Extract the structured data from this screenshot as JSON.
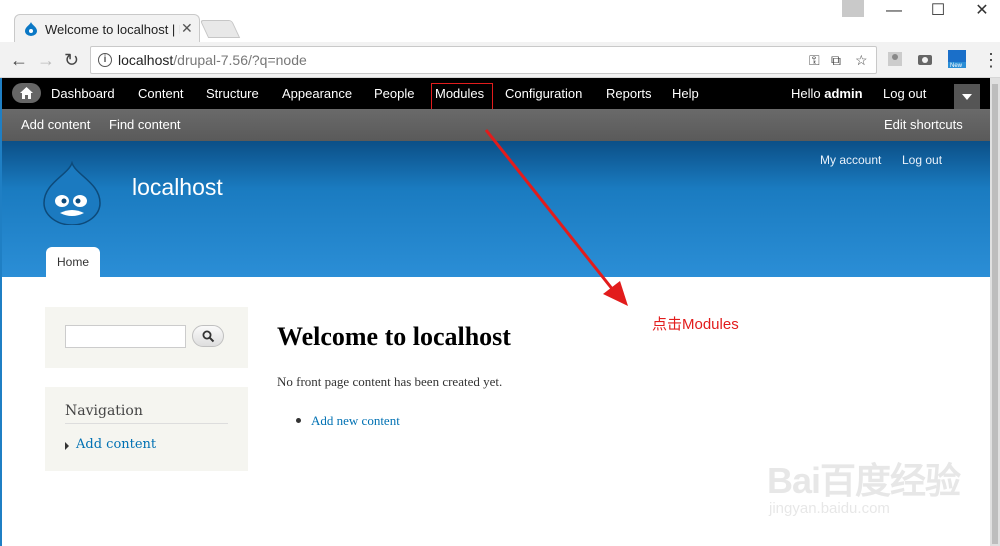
{
  "browser": {
    "tab_title": "Welcome to localhost | Drupal",
    "url_host": "localhost",
    "url_path": "/drupal-7.56/?q=node",
    "window_buttons": [
      "—",
      "☐",
      "✕"
    ]
  },
  "toolbar": {
    "items": [
      "Dashboard",
      "Content",
      "Structure",
      "Appearance",
      "People",
      "Modules",
      "Configuration",
      "Reports",
      "Help"
    ],
    "hello_prefix": "Hello ",
    "username": "admin",
    "logout": "Log out"
  },
  "shortcuts": {
    "add_content": "Add content",
    "find_content": "Find content",
    "edit_shortcuts": "Edit shortcuts"
  },
  "header": {
    "my_account": "My account",
    "logout": "Log out",
    "site_name": "localhost",
    "home_tab": "Home"
  },
  "sidebar": {
    "search_placeholder": "",
    "nav_title": "Navigation",
    "nav_link": "Add content"
  },
  "main": {
    "title": "Welcome to localhost",
    "text": "No front page content has been created yet.",
    "link": "Add new content"
  },
  "annotation": {
    "label": "点击Modules"
  },
  "watermark": {
    "text": "Bai百度经验",
    "sub": "jingyan.baidu.com"
  },
  "colors": {
    "accent": "#0071b3",
    "annotation": "#e21c1c",
    "header_top": "#0b4f87",
    "header_bottom": "#2b8ed6"
  }
}
